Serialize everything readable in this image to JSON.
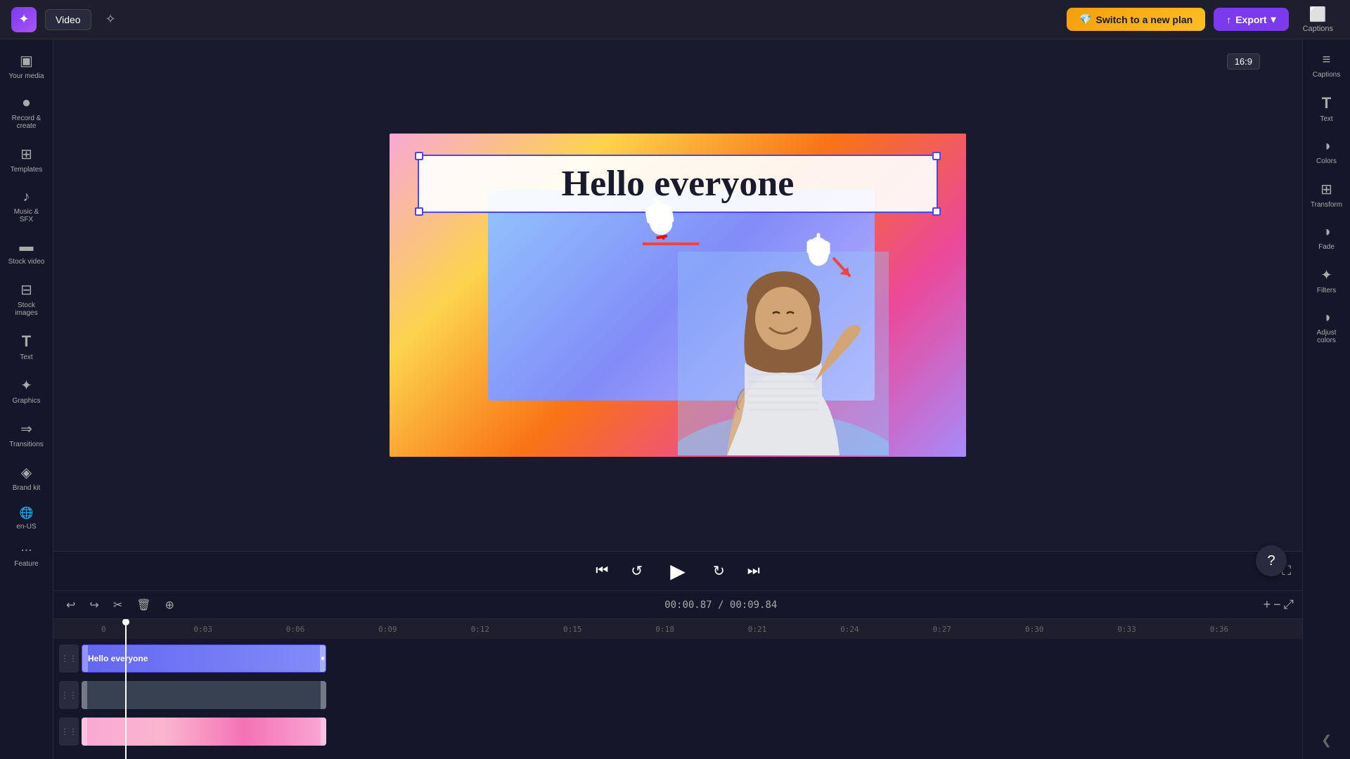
{
  "topbar": {
    "logo": "✦",
    "video_label": "Video",
    "magic_icon": "✦",
    "switch_plan_label": "Switch to a new plan",
    "switch_plan_icon": "💎",
    "export_label": "Export",
    "export_icon": "↑",
    "captions_label": "Captions",
    "aspect_ratio": "16:9"
  },
  "left_sidebar": {
    "items": [
      {
        "id": "your-media",
        "icon": "▣",
        "label": "Your media"
      },
      {
        "id": "record-create",
        "icon": "⏺",
        "label": "Record &\ncreate"
      },
      {
        "id": "templates",
        "icon": "⊞",
        "label": "Templates"
      },
      {
        "id": "music-sfx",
        "icon": "♪",
        "label": "Music & SFX"
      },
      {
        "id": "stock-video",
        "icon": "▬",
        "label": "Stock video"
      },
      {
        "id": "stock-images",
        "icon": "⊟",
        "label": "Stock images"
      },
      {
        "id": "text",
        "icon": "T",
        "label": "Text"
      },
      {
        "id": "graphics",
        "icon": "✦",
        "label": "Graphics"
      },
      {
        "id": "transitions",
        "icon": "⇒",
        "label": "Transitions"
      },
      {
        "id": "brand-kit",
        "icon": "◈",
        "label": "Brand kit"
      },
      {
        "id": "en-us",
        "icon": "🌐",
        "label": "en-US"
      },
      {
        "id": "more-features",
        "icon": "⋯",
        "label": "Feature"
      }
    ]
  },
  "canvas": {
    "text_overlay": "Hello everyone",
    "video_title": "Hello everyone"
  },
  "right_sidebar": {
    "items": [
      {
        "id": "captions",
        "icon": "≡",
        "label": "Captions"
      },
      {
        "id": "text",
        "icon": "T",
        "label": "Text"
      },
      {
        "id": "colors",
        "icon": "◑",
        "label": "Colors"
      },
      {
        "id": "transform",
        "icon": "⊞",
        "label": "Transform"
      },
      {
        "id": "fade",
        "icon": "◑",
        "label": "Fade"
      },
      {
        "id": "filters",
        "icon": "✦",
        "label": "Filters"
      },
      {
        "id": "adjust-colors",
        "icon": "◑",
        "label": "Adjust\ncolors"
      }
    ]
  },
  "player": {
    "time_current": "00:00.87",
    "time_total": "00:09.84",
    "time_separator": " / "
  },
  "timeline": {
    "ruler_marks": [
      "0",
      "0:03",
      "0:06",
      "0:09",
      "0:12",
      "0:15",
      "0:18",
      "0:21",
      "0:24",
      "0:27",
      "0:30",
      "0:33",
      "0:36"
    ],
    "tracks": [
      {
        "id": "text-track",
        "label": "Hello everyone",
        "type": "text"
      },
      {
        "id": "video-track",
        "label": "",
        "type": "video"
      },
      {
        "id": "bg-track",
        "label": "",
        "type": "background"
      }
    ]
  }
}
